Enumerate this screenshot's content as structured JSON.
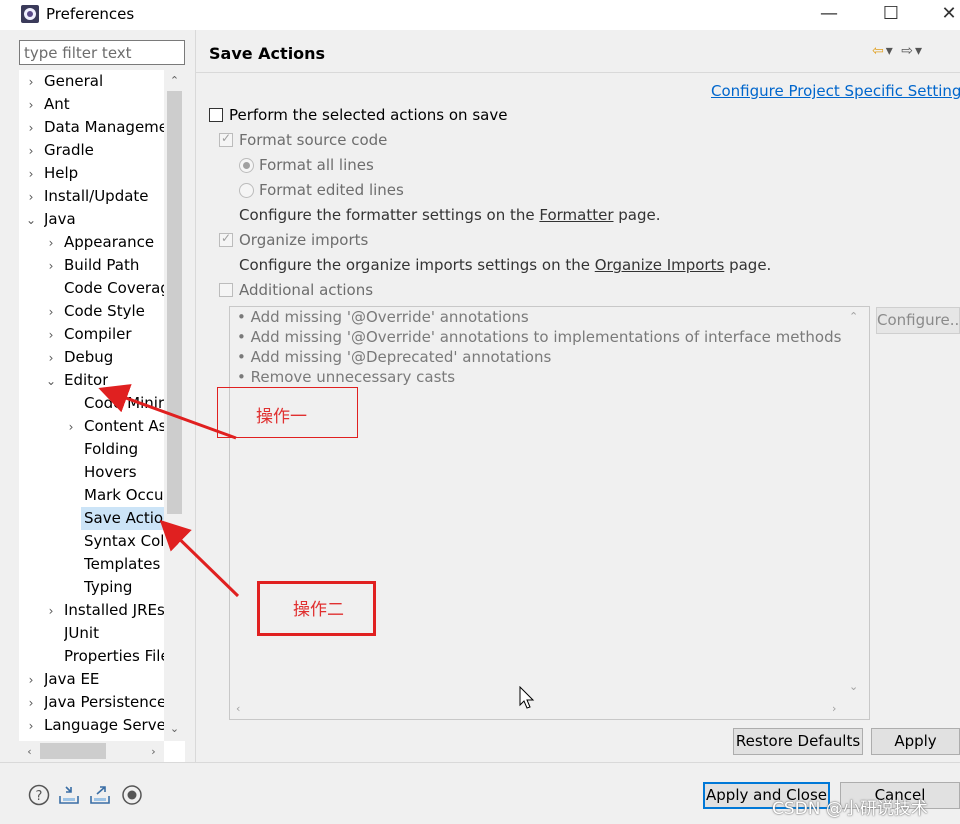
{
  "window": {
    "title": "Preferences",
    "minimize_label": "—",
    "maximize_label": "☐",
    "close_label": "✕"
  },
  "filter": {
    "placeholder": "type filter text",
    "value": ""
  },
  "tree": {
    "items": [
      {
        "label": "General",
        "arrow": "›"
      },
      {
        "label": "Ant",
        "arrow": "›"
      },
      {
        "label": "Data Manageme",
        "arrow": "›"
      },
      {
        "label": "Gradle",
        "arrow": "›"
      },
      {
        "label": "Help",
        "arrow": "›"
      },
      {
        "label": "Install/Update",
        "arrow": "›"
      },
      {
        "label": "Java",
        "arrow": "⌄"
      },
      {
        "label": "Appearance",
        "arrow": "›"
      },
      {
        "label": "Build Path",
        "arrow": "›"
      },
      {
        "label": "Code Coverag",
        "arrow": ""
      },
      {
        "label": "Code Style",
        "arrow": "›"
      },
      {
        "label": "Compiler",
        "arrow": "›"
      },
      {
        "label": "Debug",
        "arrow": "›"
      },
      {
        "label": "Editor",
        "arrow": "⌄"
      },
      {
        "label": "Code Minir",
        "arrow": ""
      },
      {
        "label": "Content As",
        "arrow": "›"
      },
      {
        "label": "Folding",
        "arrow": ""
      },
      {
        "label": "Hovers",
        "arrow": ""
      },
      {
        "label": "Mark Occu",
        "arrow": ""
      },
      {
        "label": "Save Actio",
        "arrow": ""
      },
      {
        "label": "Syntax Colo",
        "arrow": ""
      },
      {
        "label": "Templates",
        "arrow": ""
      },
      {
        "label": "Typing",
        "arrow": ""
      },
      {
        "label": "Installed JREs",
        "arrow": "›"
      },
      {
        "label": "JUnit",
        "arrow": ""
      },
      {
        "label": "Properties File",
        "arrow": ""
      },
      {
        "label": "Java EE",
        "arrow": "›"
      },
      {
        "label": "Java Persistence",
        "arrow": "›"
      },
      {
        "label": "Language Server",
        "arrow": "›"
      }
    ],
    "scroll_up": "⌃",
    "scroll_down": "⌄",
    "scroll_left": "‹",
    "scroll_right": "›"
  },
  "page": {
    "title": "Save Actions",
    "nav_back": "⇦",
    "nav_back_menu": "▾",
    "nav_forward": "⇨",
    "nav_forward_menu": "▾",
    "configure_link": "Configure Project Specific Settings...",
    "perform_label": "Perform the selected actions on save",
    "format_source_label": "Format source code",
    "format_all_label": "Format all lines",
    "format_edited_label": "Format edited lines",
    "formatter_pre": "Configure the formatter settings on the ",
    "formatter_link": "Formatter",
    "formatter_post": " page.",
    "organize_label": "Organize imports",
    "organize_pre": "Configure the organize imports settings on the ",
    "organize_link": "Organize Imports",
    "organize_post": " page.",
    "additional_label": "Additional actions",
    "actions": [
      "Add missing '@Override' annotations",
      "Add missing '@Override' annotations to implementations of interface methods",
      "Add missing '@Deprecated' annotations",
      "Remove unnecessary casts"
    ],
    "bullet": "•",
    "configure_button": "Configure...",
    "restore_button": "Restore Defaults",
    "apply_button": "Apply"
  },
  "footer": {
    "apply_close_button": "Apply and Close",
    "cancel_button": "Cancel"
  },
  "annotations": {
    "step_one": "操作一",
    "step_two": "操作二",
    "color": "#e02020"
  },
  "watermark": "CSDN @小研说技术",
  "colors": {
    "link": "#0066cc",
    "selection": "#cce4f7",
    "window_bg": "#f0f0f0"
  }
}
